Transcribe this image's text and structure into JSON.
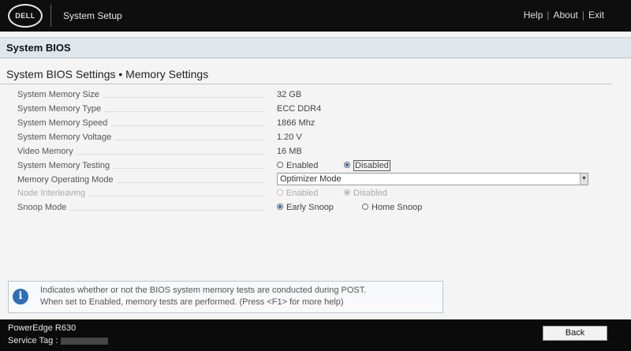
{
  "topbar": {
    "logo": "DELL",
    "app_title": "System Setup",
    "links": {
      "help": "Help",
      "about": "About",
      "exit": "Exit",
      "separator": "|"
    }
  },
  "header": {
    "title": "System BIOS"
  },
  "section": {
    "title": "System BIOS Settings • Memory Settings"
  },
  "settings": {
    "memory_size": {
      "label": "System Memory Size",
      "value": "32 GB"
    },
    "memory_type": {
      "label": "System Memory Type",
      "value": "ECC DDR4"
    },
    "memory_speed": {
      "label": "System Memory Speed",
      "value": "1866 Mhz"
    },
    "memory_voltage": {
      "label": "System Memory Voltage",
      "value": "1.20 V"
    },
    "video_memory": {
      "label": "Video Memory",
      "value": "16 MB"
    },
    "memory_testing": {
      "label": "System Memory Testing",
      "options": [
        "Enabled",
        "Disabled"
      ],
      "selected": "Disabled"
    },
    "operating_mode": {
      "label": "Memory Operating Mode",
      "value": "Optimizer Mode"
    },
    "node_interleaving": {
      "label": "Node Interleaving",
      "options": [
        "Enabled",
        "Disabled"
      ],
      "selected": "Disabled",
      "disabled": true
    },
    "snoop_mode": {
      "label": "Snoop Mode",
      "options": [
        "Early Snoop",
        "Home Snoop"
      ],
      "selected": "Early Snoop"
    }
  },
  "help": {
    "icon": "info-icon",
    "line1": "Indicates whether or not the BIOS system memory tests are conducted during POST.",
    "line2": "When set to Enabled, memory tests are performed. (Press <F1> for more help)"
  },
  "footer": {
    "model": "PowerEdge R630",
    "service_tag_label": "Service Tag :",
    "back_label": "Back"
  },
  "colors": {
    "accent": "#2f6fb5",
    "header_band": "#dfe6ec",
    "bar": "#0e0e0e"
  }
}
